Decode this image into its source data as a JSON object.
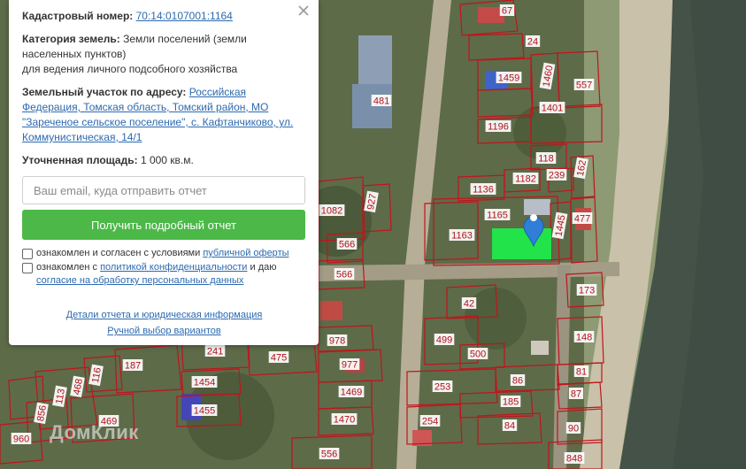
{
  "panel": {
    "cadastral_label": "Кадастровый номер:",
    "cadastral_number": "70:14:0107001:1164",
    "category_label": "Категория земель:",
    "category_value": "Земли поселений (земли населенных пунктов)",
    "usage": "для ведения личного подсобного хозяйства",
    "address_label": "Земельный участок по адресу:",
    "address_value": "Российская Федерация, Томская область, Томский район, МО \"Зареченое сельское поселение\", с. Кафтанчиково, ул. Коммунистическая, 14/1",
    "area_label": "Уточненная площадь:",
    "area_value": "1 000 кв.м.",
    "email_placeholder": "Ваш email, куда отправить отчет",
    "submit_label": "Получить подробный отчет",
    "consent1_text": "ознакомлен и согласен с условиями",
    "consent1_link": "публичной оферты",
    "consent2_text": "ознакомлен с",
    "consent2_link": "политикой конфиденциальности",
    "consent2_mid": "и даю",
    "consent2_link2": "согласие на обработку персональных данных",
    "details_link": "Детали отчета и юридическая информация",
    "manual_link": "Ручной выбор вариантов"
  },
  "watermark": "ДомКлик",
  "parcel_labels": [
    "67",
    "24",
    "1460",
    "557",
    "1459",
    "481",
    "1401",
    "1196",
    "118",
    "239",
    "162",
    "1182",
    "1136",
    "1165",
    "1445",
    "477",
    "1082",
    "927",
    "1163",
    "566",
    "566",
    "173",
    "42",
    "499",
    "978",
    "500",
    "148",
    "475",
    "187",
    "241",
    "977",
    "1454",
    "86",
    "81",
    "468",
    "116",
    "253",
    "1469",
    "87",
    "185",
    "113",
    "1455",
    "254",
    "856",
    "469",
    "1470",
    "84",
    "90",
    "960",
    "556",
    "848"
  ],
  "colors": {
    "accent_green": "#4cb848",
    "selected_parcel": "#22e34a",
    "parcel_border": "#c0141c",
    "marker": "#2f7fd8",
    "link": "#2c6ab0"
  }
}
